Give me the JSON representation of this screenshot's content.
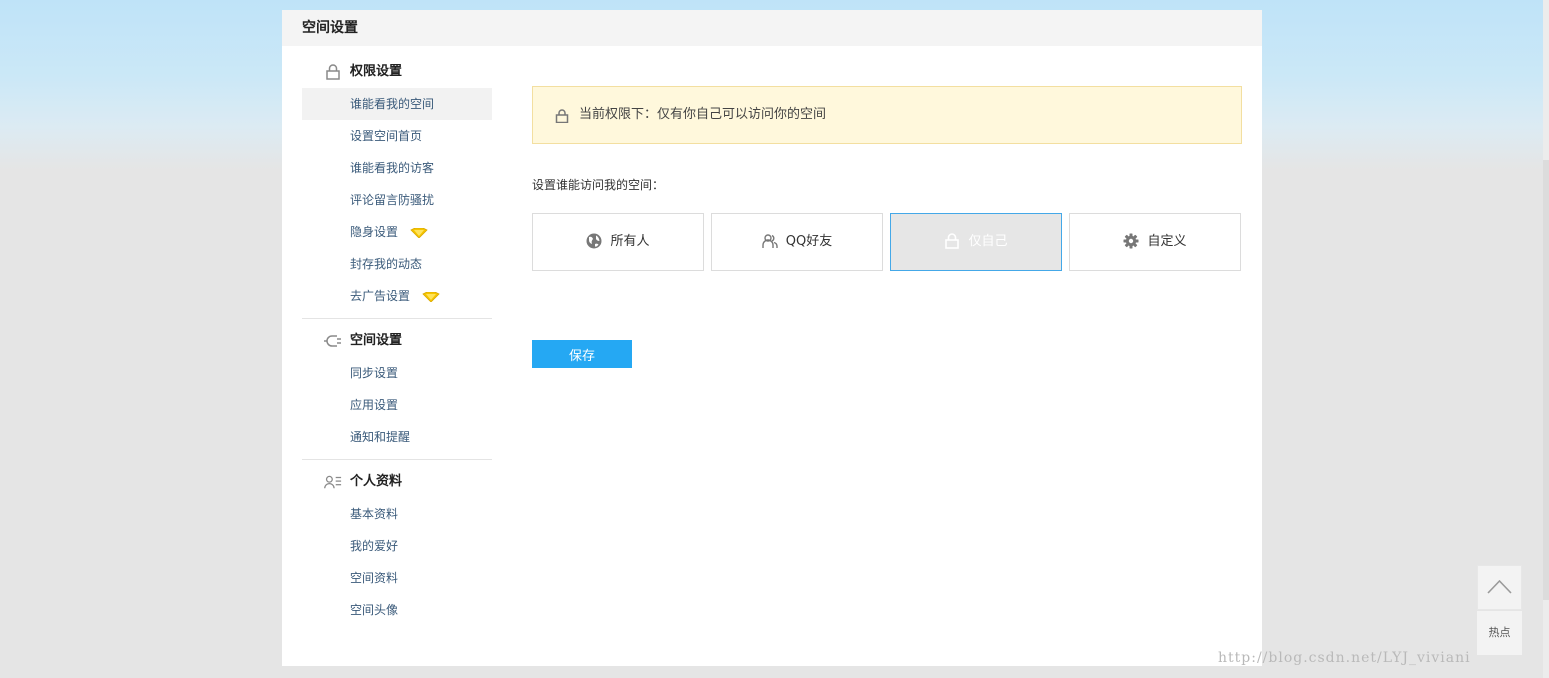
{
  "panel": {
    "title": "空间设置"
  },
  "sidebar": {
    "groups": [
      {
        "title": "权限设置",
        "icon": "lock-icon",
        "items": [
          {
            "label": "谁能看我的空间",
            "active": true
          },
          {
            "label": "设置空间首页"
          },
          {
            "label": "谁能看我的访客"
          },
          {
            "label": "评论留言防骚扰"
          },
          {
            "label": "隐身设置",
            "badge": "diamond-icon"
          },
          {
            "label": "封存我的动态"
          },
          {
            "label": "去广告设置",
            "badge": "diamond-icon"
          }
        ]
      },
      {
        "title": "空间设置",
        "icon": "plug-icon",
        "items": [
          {
            "label": "同步设置"
          },
          {
            "label": "应用设置"
          },
          {
            "label": "通知和提醒"
          }
        ]
      },
      {
        "title": "个人资料",
        "icon": "profile-card-icon",
        "items": [
          {
            "label": "基本资料"
          },
          {
            "label": "我的爱好"
          },
          {
            "label": "空间资料"
          },
          {
            "label": "空间头像"
          }
        ]
      }
    ]
  },
  "main": {
    "notice": "当前权限下：仅有你自己可以访问你的空间",
    "section_label": "设置谁能访问我的空间：",
    "options": [
      {
        "label": "所有人",
        "icon": "globe-icon"
      },
      {
        "label": "QQ好友",
        "icon": "friends-icon"
      },
      {
        "label": "仅自己",
        "icon": "lock-icon",
        "selected": true
      },
      {
        "label": "自定义",
        "icon": "gear-icon"
      }
    ],
    "save_label": "保存"
  },
  "float": {
    "hot_label": "热点"
  },
  "watermark": "http://blog.csdn.net/LYJ_viviani",
  "colors": {
    "accent": "#25a8f3",
    "notice_bg": "#fff8dc",
    "selected_border": "#44a8e8"
  }
}
